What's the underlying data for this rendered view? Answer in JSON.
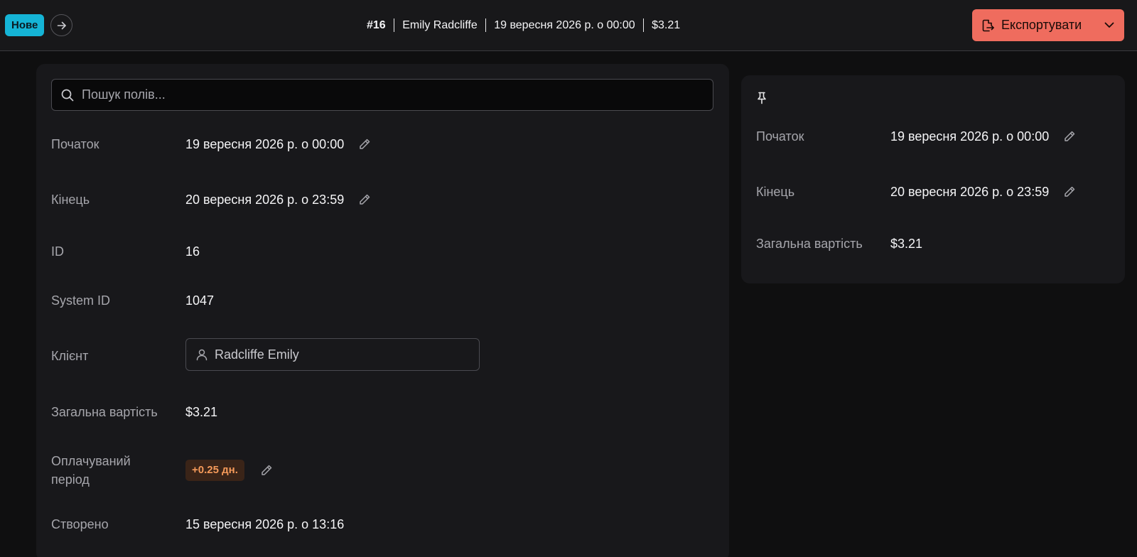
{
  "header": {
    "status_label": "Нове",
    "summary": {
      "number": "#16",
      "client": "Emily Radcliffe",
      "date": "19 вересня 2026 р. о 00:00",
      "amount": "$3.21"
    },
    "export_label": "Експортувати"
  },
  "colors": {
    "status_badge": "#15b4d6",
    "export_button": "#ef6c5e",
    "period_badge_bg": "#3a2418",
    "period_badge_text": "#f59a5a"
  },
  "search": {
    "placeholder": "Пошук полів..."
  },
  "fields": {
    "start": {
      "label": "Початок",
      "value": "19 вересня 2026 р. о 00:00"
    },
    "end": {
      "label": "Кінець",
      "value": "20 вересня 2026 р. о 23:59"
    },
    "id": {
      "label": "ID",
      "value": "16"
    },
    "system_id": {
      "label": "System ID",
      "value": "1047"
    },
    "client": {
      "label": "Клієнт",
      "value": "Radcliffe Emily"
    },
    "total": {
      "label": "Загальна вартість",
      "value": "$3.21"
    },
    "billing_period": {
      "label_line1": "Оплачуваний",
      "label_line2": "період",
      "value": "+0.25 дн."
    },
    "created": {
      "label": "Створено",
      "value": "15 вересня 2026 р. о 13:16"
    }
  },
  "pinned": {
    "start": {
      "label": "Початок",
      "value": "19 вересня 2026 р. о 00:00"
    },
    "end": {
      "label": "Кінець",
      "value": "20 вересня 2026 р. о 23:59"
    },
    "total": {
      "label": "Загальна вартість",
      "value": "$3.21"
    }
  },
  "icons": {
    "forward": "arrow-right-icon",
    "export": "export-file-icon",
    "dropdown": "chevron-down-icon",
    "search": "search-icon",
    "edit": "pencil-icon",
    "client": "user-icon",
    "pin": "pin-icon"
  }
}
